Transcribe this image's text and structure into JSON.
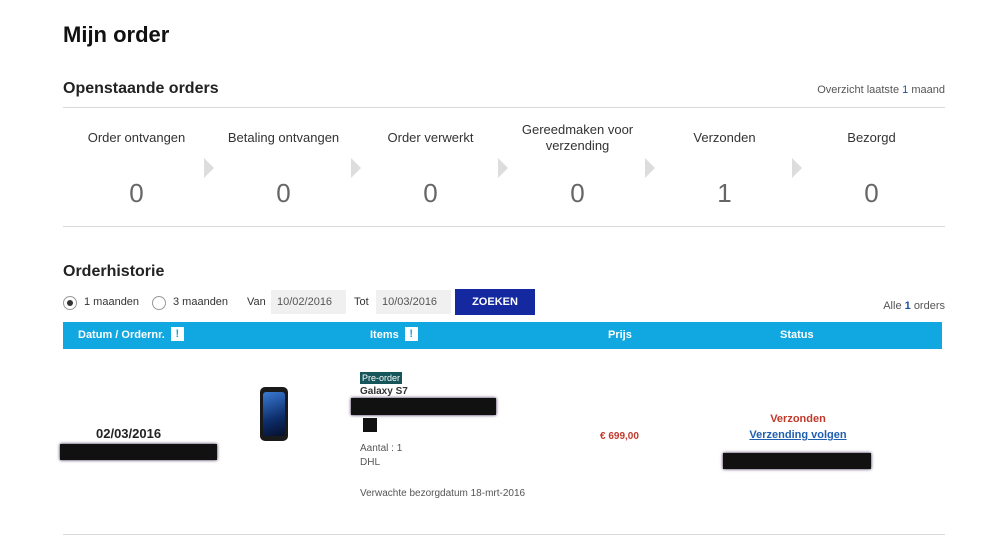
{
  "page": {
    "title": "Mijn order"
  },
  "open_orders": {
    "title": "Openstaande orders",
    "overview_prefix": "Overzicht laatste",
    "overview_num": "1",
    "overview_suffix": "maand",
    "steps": [
      {
        "label": "Order ontvangen",
        "count": "0"
      },
      {
        "label": "Betaling ontvangen",
        "count": "0"
      },
      {
        "label": "Order verwerkt",
        "count": "0"
      },
      {
        "label": "Gereedmaken voor verzending",
        "count": "0"
      },
      {
        "label": "Verzonden",
        "count": "1"
      },
      {
        "label": "Bezorgd",
        "count": "0"
      }
    ]
  },
  "history": {
    "title": "Orderhistorie",
    "range_options": [
      {
        "label": "1 maanden",
        "selected": true
      },
      {
        "label": "3 maanden",
        "selected": false
      }
    ],
    "from_label": "Van",
    "from_date": "10/02/2016",
    "to_label": "Tot",
    "to_date": "10/03/2016",
    "search_label": "ZOEKEN",
    "count_prefix": "Alle",
    "count_num": "1",
    "count_suffix": "orders"
  },
  "table": {
    "headers": {
      "date": "Datum / Ordernr.",
      "items": "Items",
      "price": "Prijs",
      "status": "Status"
    },
    "info_icon": "!",
    "header_color": "#11a7e0"
  },
  "order": {
    "date": "02/03/2016",
    "badge": "Pre-order",
    "product": "Galaxy S7",
    "quantity": "Aantal : 1",
    "carrier": "DHL",
    "delivery": "Verwachte bezorgdatum 18-mrt-2016",
    "price": "€ 699,00",
    "status": "Verzonden",
    "tracking_link": "Verzending volgen"
  },
  "colors": {
    "primary_button": "#1428a0",
    "status_red": "#c0392b",
    "link_blue": "#1f5fb0"
  }
}
